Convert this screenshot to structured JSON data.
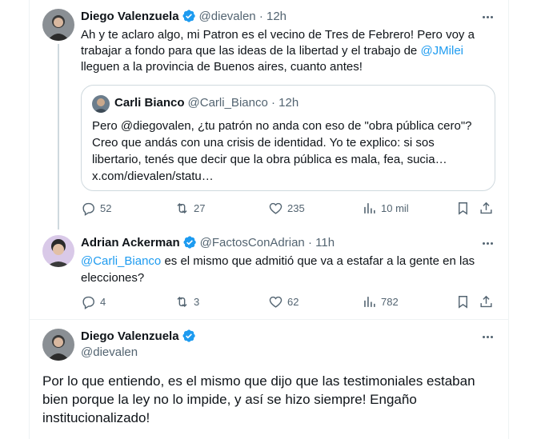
{
  "tweet1": {
    "name": "Diego Valenzuela",
    "handle": "@dievalen",
    "time": "12h",
    "line1": "Ah y te aclaro algo, mi Patron es el vecino de Tres de Febrero! Pero voy a",
    "line2_pre": "trabajar a fondo para que las ideas de la libertad y el trabajo de ",
    "line2_mention": "@JMilei",
    "line3": "lleguen a la provincia de Buenos aires, cuanto antes!",
    "quote": {
      "name": "Carli Bianco",
      "handle": "@Carli_Bianco",
      "time": "12h",
      "line1": "Pero @diegovalen, ¿tu patrón no anda con eso de \"obra pública cero\"?",
      "line2": "Creo que andás con una crisis de identidad. Yo te explico: si sos",
      "line3": "libertario, tenés que decir que la obra pública es mala, fea, sucia…",
      "line4": "x.com/dievalen/statu…"
    },
    "replies": "52",
    "retweets": "27",
    "likes": "235",
    "views": "10 mil"
  },
  "tweet2": {
    "name": "Adrian Ackerman",
    "handle": "@FactosConAdrian",
    "time": "11h",
    "mention": "@Carli_Bianco",
    "line1_post": " es el mismo que admitió que va a estafar a la gente en las",
    "line2": "elecciones?",
    "replies": "4",
    "retweets": "3",
    "likes": "62",
    "views": "782"
  },
  "tweet3": {
    "name": "Diego Valenzuela",
    "handle": "@dievalen",
    "line1": "Por lo que entiendo, es el mismo que dijo que las testimoniales estaban",
    "line2": "bien porque la ley no lo impide, y así se hizo siempre! Engaño",
    "line3": "institucionalizado!"
  },
  "colors": {
    "accent": "#1d9bf0",
    "muted": "#536471",
    "border": "#cfd9de"
  },
  "icons": {
    "verified": "verified-badge-icon",
    "reply": "reply-icon",
    "retweet": "retweet-icon",
    "like": "heart-icon",
    "views": "views-chart-icon",
    "bookmark": "bookmark-icon",
    "share": "share-icon",
    "more": "more-options-icon"
  }
}
